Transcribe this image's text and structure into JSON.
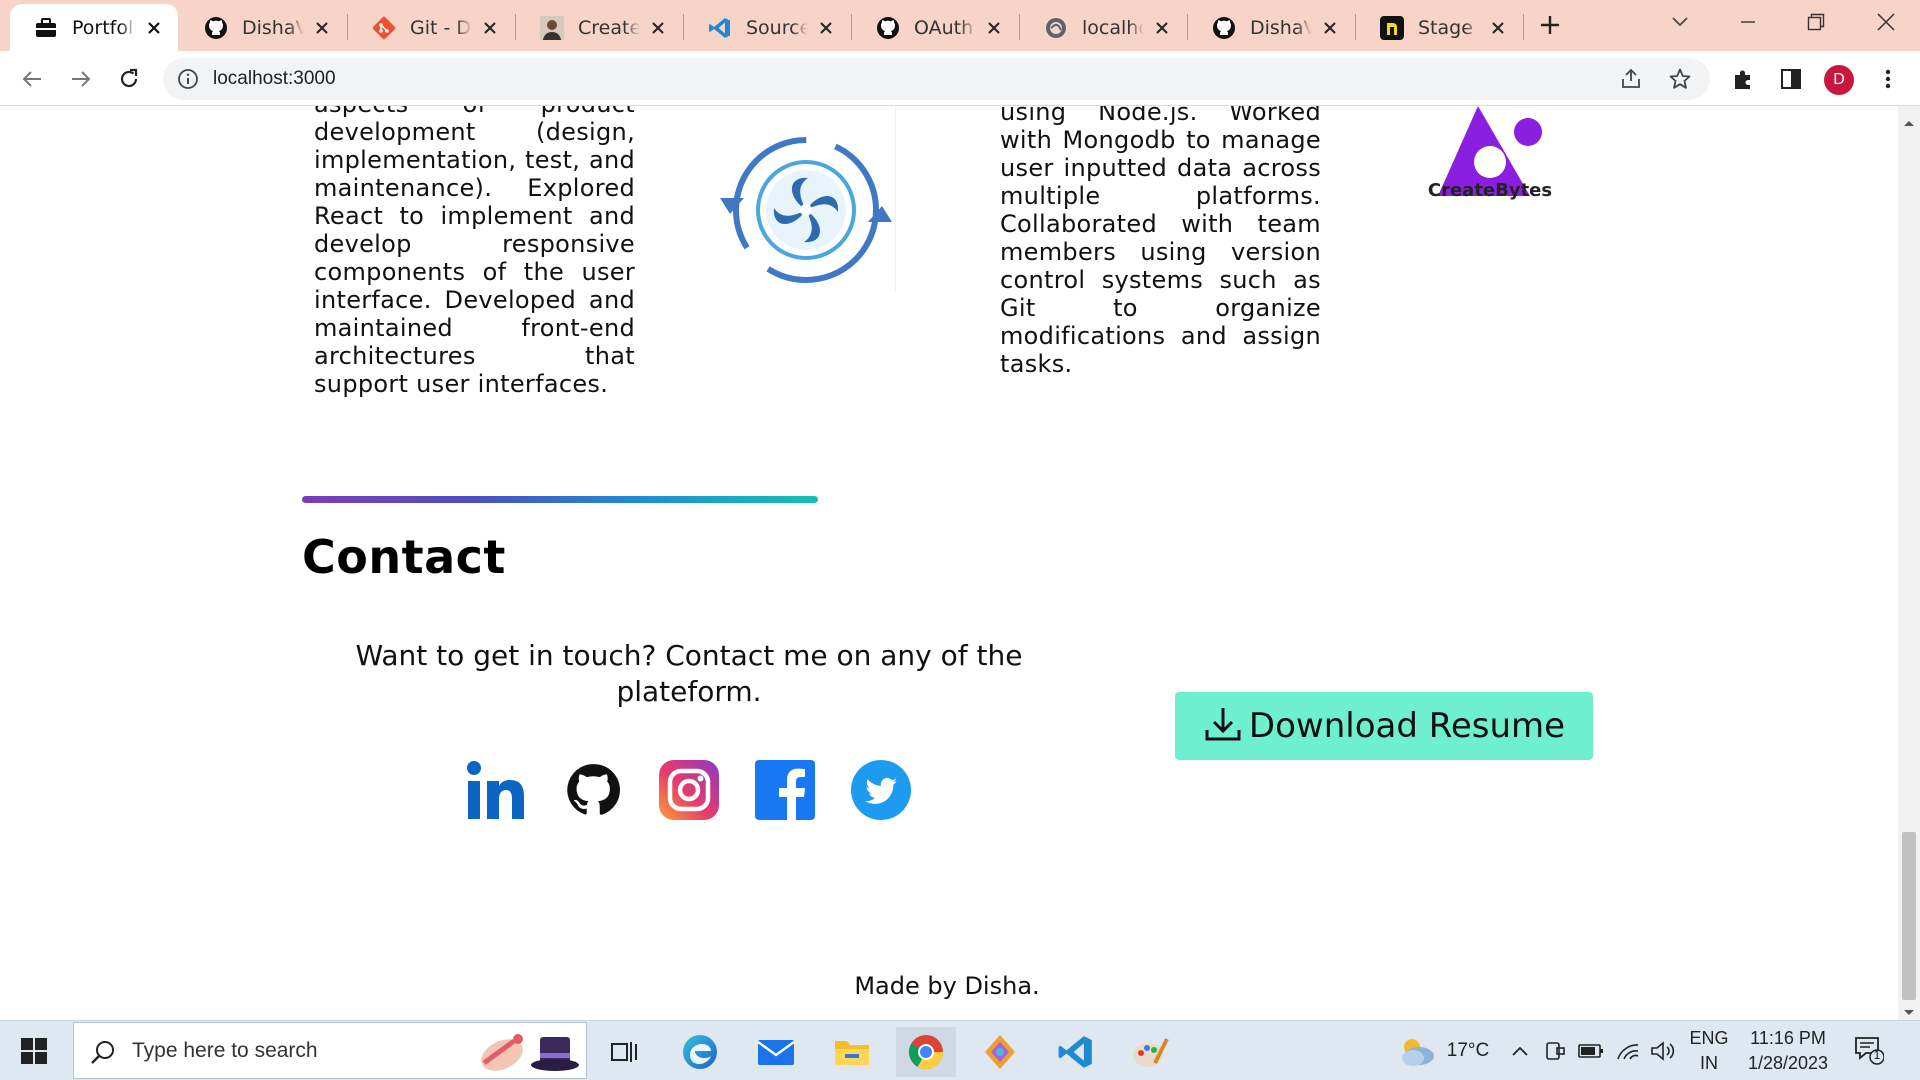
{
  "browser": {
    "tabs": [
      {
        "title": "Portfolio",
        "favicon": "briefcase-icon",
        "active": true
      },
      {
        "title": "DishaVaishnav",
        "favicon": "github-icon"
      },
      {
        "title": "Git - Downloads",
        "favicon": "git-icon"
      },
      {
        "title": "Create Your",
        "favicon": "profile-icon"
      },
      {
        "title": "Source Control",
        "favicon": "vscode-icon"
      },
      {
        "title": "OAuth apps",
        "favicon": "github-icon"
      },
      {
        "title": "localhost",
        "favicon": "globe-icon"
      },
      {
        "title": "DishaVaishnav",
        "favicon": "github-icon"
      },
      {
        "title": "Stage & Commit",
        "favicon": "stage-icon"
      }
    ],
    "url": "localhost:3000",
    "profile_initial": "D"
  },
  "experience": {
    "left_text": "aspects of product development (design, implementation, test, and maintenance). Explored React to implement and develop responsive components of the user interface. Developed and maintained front-end architectures that support user interfaces.",
    "right_text": "using Node.js. Worked with Mongodb to manage user inputted data across multiple platforms. Collaborated with team members using version control systems such as Git to organize modifications and assign tasks.",
    "company_logo_text": "CreateBytes"
  },
  "contact": {
    "title": "Contact",
    "message": "Want to get in touch? Contact me on any of the plateform.",
    "socials": [
      "linkedin-icon",
      "github-icon",
      "instagram-icon",
      "facebook-icon",
      "twitter-icon"
    ],
    "resume_button": "Download Resume"
  },
  "footer": {
    "text": "Made by Disha."
  },
  "taskbar": {
    "search_placeholder": "Type here to search",
    "weather": "17°C",
    "language_line1": "ENG",
    "language_line2": "IN",
    "time": "11:16 PM",
    "date": "1/28/2023",
    "notification_count": "1"
  }
}
